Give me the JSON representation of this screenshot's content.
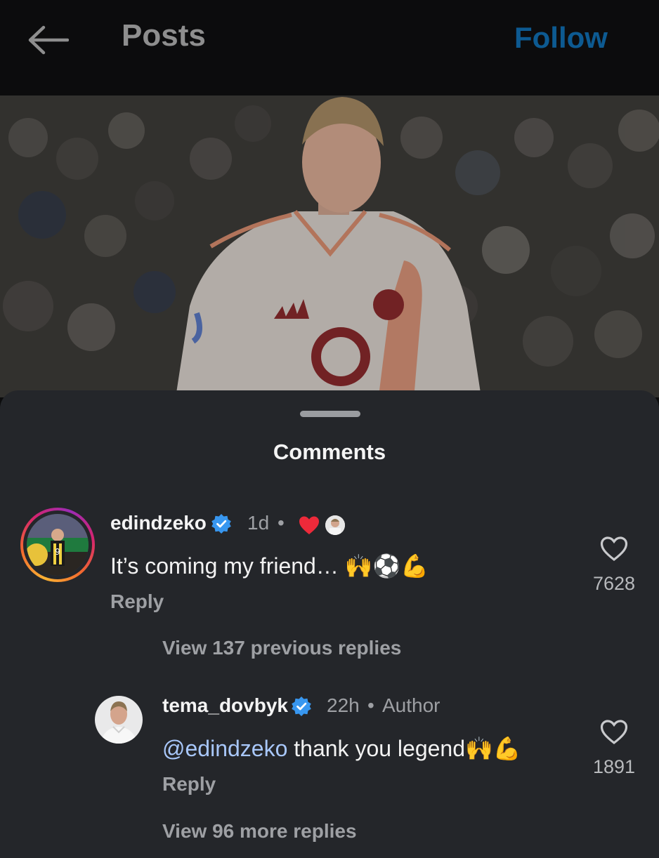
{
  "header": {
    "title": "Posts",
    "follow_label": "Follow"
  },
  "sheet": {
    "title": "Comments"
  },
  "comments": [
    {
      "username": "edindzeko",
      "time": "1d",
      "text": "It’s coming my friend…",
      "emoji": "🙌⚽💪",
      "reply_label": "Reply",
      "likes": "7628",
      "view_replies": "View 137 previous replies"
    },
    {
      "username": "tema_dovbyk",
      "time": "22h",
      "author_label": "Author",
      "mention": "@edindzeko",
      "text": " thank you legend",
      "emoji": "🙌💪",
      "reply_label": "Reply",
      "likes": "1891",
      "view_replies": "View 96 more replies"
    }
  ],
  "colors": {
    "background": "#0c0c0d",
    "sheet": "#24262a",
    "follow": "#0d5a91",
    "verified": "#3897f0",
    "heart": "#ed2a3a",
    "mention": "#a8c7fa"
  },
  "icons": {
    "back": "arrow-left-icon",
    "verified": "verified-badge-icon",
    "like": "heart-outline-icon",
    "liked_by_author": "heart-filled-icon"
  }
}
